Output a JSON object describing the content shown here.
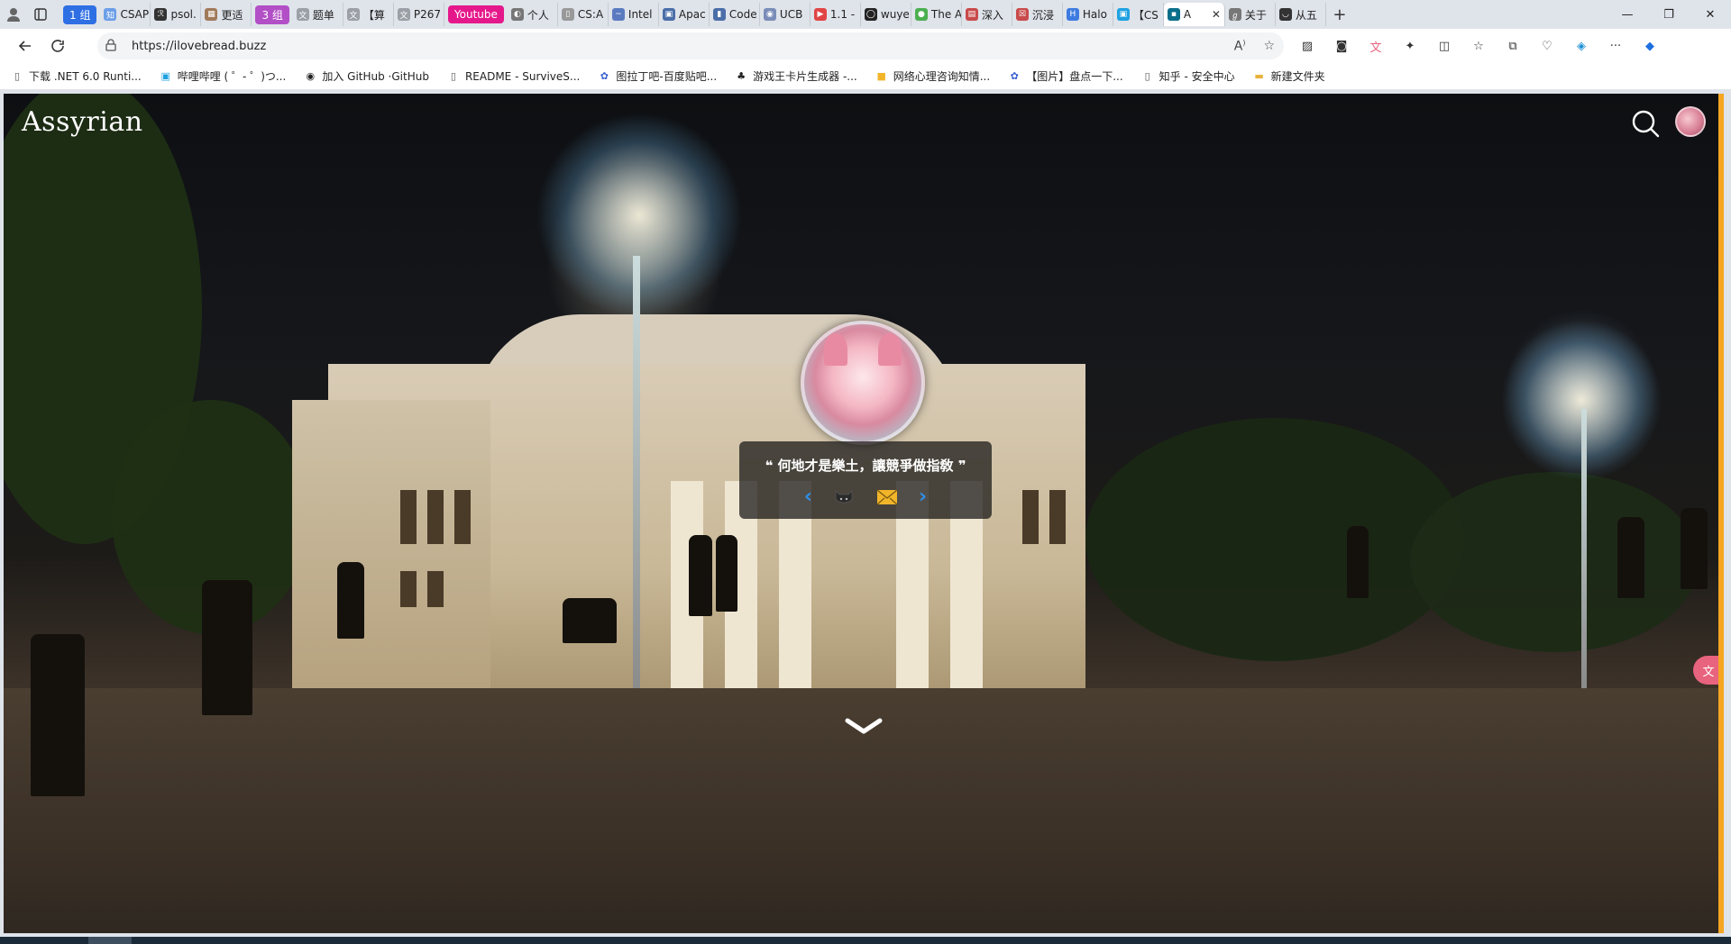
{
  "browser": {
    "tab_groups": {
      "group1": {
        "label": "1 组",
        "color": "#2f6fe4"
      },
      "group3": {
        "label": "3 组",
        "color": "#b24fc6"
      }
    },
    "tabs": [
      {
        "title": "CSAP",
        "fav": "知",
        "color": "#6b9ee8"
      },
      {
        "title": "psol.",
        "fav": "ℛ",
        "color": "#333333"
      },
      {
        "title": "更适",
        "fav": "▦",
        "color": "#a07a5a"
      },
      {
        "title": "题单",
        "fav": "文",
        "color": "#9aa0a6"
      },
      {
        "title": "【算",
        "fav": "文",
        "color": "#9aa0a6"
      },
      {
        "title": "P267",
        "fav": "文",
        "color": "#9aa0a6"
      },
      {
        "title": "个人",
        "fav": "◐",
        "color": "#777777"
      },
      {
        "title": "CS:A",
        "fav": "▯",
        "color": "#999999"
      },
      {
        "title": "Intel",
        "fav": "~",
        "color": "#5a7ac0"
      },
      {
        "title": "Apac",
        "fav": "▣",
        "color": "#4a6ea8"
      },
      {
        "title": "Code",
        "fav": "▮",
        "color": "#4a6ea8"
      },
      {
        "title": "UCB",
        "fav": "◉",
        "color": "#7a8cb8"
      },
      {
        "title": "1.1 -",
        "fav": "▶",
        "color": "#e04444"
      },
      {
        "title": "wuye",
        "fav": "◯",
        "color": "#222222"
      },
      {
        "title": "The A",
        "fav": "●",
        "color": "#4caf50"
      },
      {
        "title": "深入",
        "fav": "▤",
        "color": "#c94a4a"
      },
      {
        "title": "沉浸",
        "fav": "☒",
        "color": "#c94a4a"
      },
      {
        "title": "Halo",
        "fav": "H",
        "color": "#3d7be0"
      }
    ],
    "youtube_tab": "Youtube",
    "more_tabs": [
      {
        "title": "【CS",
        "fav": "▣",
        "color": "#1ea1e0"
      },
      {
        "title": "A",
        "fav": "▪",
        "color": "#0a6e8a",
        "active": true
      },
      {
        "title": "关于",
        "fav": "ℊ",
        "color": "#777777"
      },
      {
        "title": "从五",
        "fav": "◡",
        "color": "#333333"
      }
    ],
    "url": "https://ilovebread.buzz",
    "bookmarks": [
      {
        "label": "下载 .NET 6.0 Runti...",
        "icon": "page-icon"
      },
      {
        "label": "哔哩哔哩 ( ゜- ゜)つ...",
        "icon": "bilibili-icon"
      },
      {
        "label": "加入 GitHub ·GitHub",
        "icon": "github-icon"
      },
      {
        "label": "README - SurviveS...",
        "icon": "page-icon"
      },
      {
        "label": "图拉丁吧-百度贴吧...",
        "icon": "baidu-icon"
      },
      {
        "label": "游戏王卡片生成器 -...",
        "icon": "paw-icon"
      },
      {
        "label": "网络心理咨询知情...",
        "icon": "yellow-icon"
      },
      {
        "label": "【图片】盘点一下...",
        "icon": "baidu-icon"
      },
      {
        "label": "知乎 - 安全中心",
        "icon": "page-icon"
      },
      {
        "label": "新建文件夹",
        "icon": "folder-icon"
      }
    ]
  },
  "site": {
    "title": "Assyrian",
    "quote": "何地才是樂土，讓競爭做指敎",
    "accent": "#f5a623",
    "link_color": "#2f8fe8"
  }
}
